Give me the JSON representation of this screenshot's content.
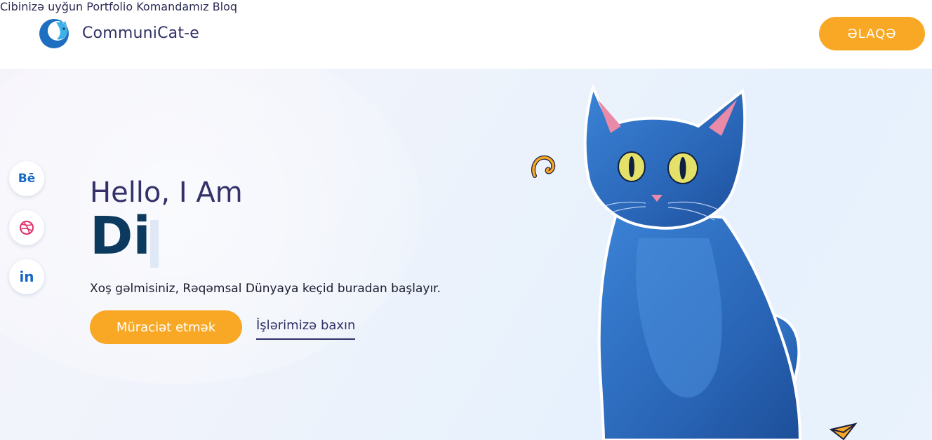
{
  "brand": {
    "name": "CommuniCat-e"
  },
  "nav": {
    "items": [
      {
        "label": "Cibinizə uyğun"
      },
      {
        "label": "Portfolio"
      },
      {
        "label": "Komandamız"
      },
      {
        "label": "Bloq"
      }
    ],
    "contact_label": "ƏLAQƏ"
  },
  "social": [
    {
      "icon": "behance-icon",
      "label": "Bē"
    },
    {
      "icon": "dribbble-icon"
    },
    {
      "icon": "linkedin-icon",
      "label": "in"
    }
  ],
  "hero": {
    "greeting": "Hello, I Am",
    "typed_text": "Di",
    "subtitle": "Xoş gəlmisiniz, Rəqəmsal Dünyaya keçid buradan başlayır.",
    "primary_button": "Müraciət etmək",
    "secondary_link": "İşlərimizə baxın"
  },
  "colors": {
    "accent": "#f9a825",
    "navy": "#0b3a5e",
    "text": "#2f3265",
    "cat_blue": "#2f6fc0"
  }
}
